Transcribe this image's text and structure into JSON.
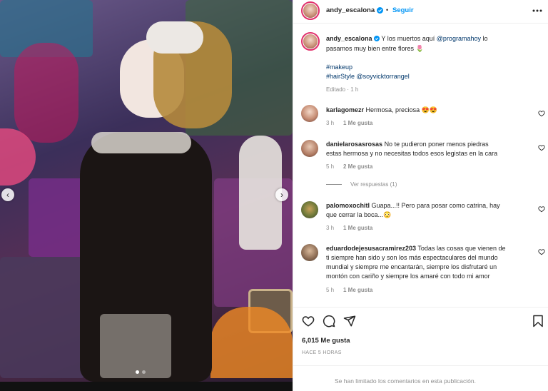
{
  "header": {
    "username": "andy_escalona",
    "follow_label": "Seguir",
    "more_icon": "more-horizontal-icon"
  },
  "caption": {
    "username": "andy_escalona",
    "text_1": "Y los muertos aquí",
    "mention_1": "@programahoy",
    "text_2": "lo",
    "line_2": "pasamos muy bien entre flores 🌷",
    "hashtag_1": "#makeup",
    "hashtag_2": "#hairStyle",
    "mention_2": "@soyvicktorrangel",
    "edited": "Editado · 1 h"
  },
  "comments": [
    {
      "username": "karlagomezr",
      "lines": [
        "Hermosa, preciosa 😍😍"
      ],
      "time": "3 h",
      "likes": "1 Me gusta"
    },
    {
      "username": "danielarosasrosas",
      "lines": [
        "No te pudieron poner menos piedras",
        "estas hermosa y no necesitas todos esos legistas en la cara"
      ],
      "time": "5 h",
      "likes": "2 Me gusta",
      "replies": "Ver respuestas (1)"
    },
    {
      "username": "palomoxochitl",
      "lines": [
        "Guapa...!! Pero para posar como catrina, hay",
        "que cerrar la boca...😳"
      ],
      "time": "3 h",
      "likes": "1 Me gusta"
    },
    {
      "username": "eduardodejesusacramirez203",
      "lines": [
        "Todas las cosas que vienen de",
        "ti siempre han sido y son los más espectaculares del mundo",
        "mundial y siempre me encantarán, siempre los disfrutaré un",
        "montón con cariño y siempre los amaré con todo mi amor"
      ],
      "time": "5 h",
      "likes": "1 Me gusta"
    }
  ],
  "actions": {
    "likes_count": "6,015 Me gusta",
    "posted": "HACE 5 HORAS",
    "comments_limited": "Se han limitado los comentarios en esta publicación."
  },
  "colors": {
    "verified": "#0095f6",
    "follow": "#0095f6",
    "link": "#00376b",
    "muted": "#8e8e8e"
  }
}
